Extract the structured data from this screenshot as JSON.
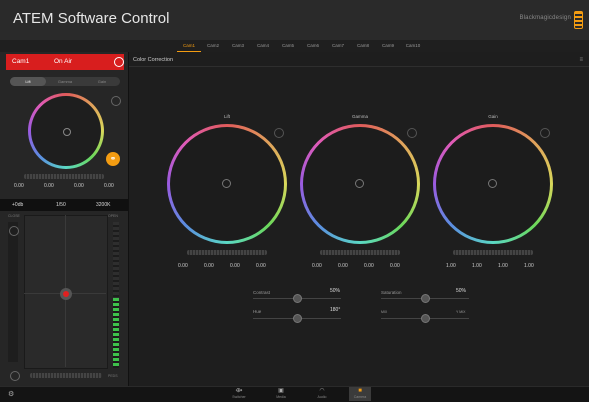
{
  "app": {
    "title": "ATEM Software Control",
    "brand": "Blackmagicdesign"
  },
  "cameras": [
    "Cam1",
    "Cam2",
    "Cam3",
    "Cam4",
    "Cam5",
    "Cam6",
    "Cam7",
    "Cam8",
    "Cam9",
    "Cam10"
  ],
  "camera_panel": {
    "camera_name": "Cam1",
    "onair_label": "On Air",
    "subtabs": [
      "Lift",
      "Gamma",
      "Gain"
    ],
    "wheel_values": [
      "0.00",
      "0.00",
      "0.00",
      "0.00"
    ],
    "gain": "+0db",
    "shutter": "1/50",
    "white_balance": "3200K",
    "iris_label": "CLOSE",
    "focus_label": "OPEN",
    "ped_label": "PEDS"
  },
  "color_correction": {
    "title": "Color Correction",
    "wheels": [
      {
        "label": "Lift",
        "values": [
          "0.00",
          "0.00",
          "0.00",
          "0.00"
        ]
      },
      {
        "label": "Gamma",
        "values": [
          "0.00",
          "0.00",
          "0.00",
          "0.00"
        ]
      },
      {
        "label": "Gain",
        "values": [
          "1.00",
          "1.00",
          "1.00",
          "1.00"
        ]
      }
    ],
    "contrast": {
      "label": "Contrast",
      "value": "50%",
      "level": 0.5
    },
    "hue": {
      "label": "Hue",
      "value": "180°",
      "level": 0.5
    },
    "saturation": {
      "label": "Saturation",
      "value": "50%",
      "level": 0.5
    },
    "mix": {
      "label": "MIX",
      "value_label": "Y MIX",
      "level": 0.5
    }
  },
  "nav": [
    {
      "label": "Switcher",
      "icon": "switcher-icon"
    },
    {
      "label": "Media",
      "icon": "media-icon"
    },
    {
      "label": "Audio",
      "icon": "audio-icon"
    },
    {
      "label": "Camera",
      "icon": "camera-icon",
      "active": true
    }
  ],
  "colors": {
    "accent": "#f39c12",
    "onair": "#d81e1e"
  }
}
